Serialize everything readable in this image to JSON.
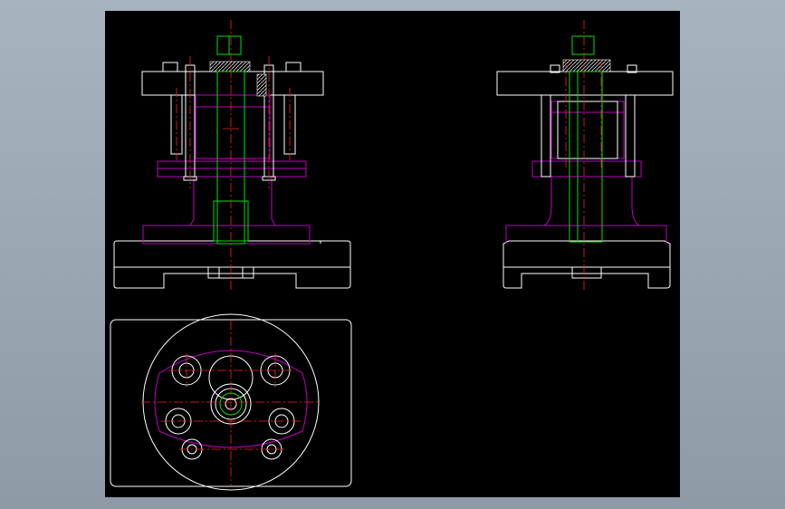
{
  "drawing": {
    "background_color": "#000000",
    "frame_color": "#a7b3bf",
    "line_colors": {
      "outline": "#ffffff",
      "shaft": "#00e000",
      "base_part": "#c000c0",
      "center_lines": "#ff2020"
    },
    "views": [
      {
        "id": "front-view",
        "kind": "section"
      },
      {
        "id": "side-view",
        "kind": "section"
      },
      {
        "id": "top-view",
        "kind": "plan"
      }
    ]
  }
}
